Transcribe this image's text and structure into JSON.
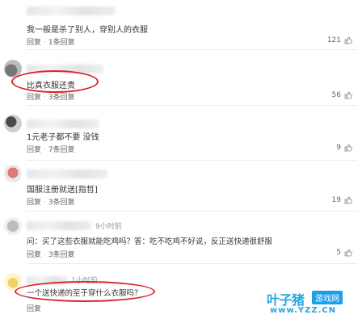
{
  "comments": [
    {
      "text": "我一般是杀了别人，穿别人的衣服",
      "reply_label": "回复",
      "replies_label": "1条回复",
      "likes": "121",
      "time": ""
    },
    {
      "text": "比真衣服还贵",
      "reply_label": "回复",
      "replies_label": "3条回复",
      "likes": "56",
      "time": ""
    },
    {
      "text": "1元老子都不要 没钱",
      "reply_label": "回复",
      "replies_label": "7条回复",
      "likes": "9",
      "time": ""
    },
    {
      "text": "国服注册就送[指哲]",
      "reply_label": "回复",
      "replies_label": "3条回复",
      "likes": "19",
      "time": ""
    },
    {
      "text": "问：买了这些衣服就能吃鸡吗？答：吃不吃鸡不好说，反正送快递很舒服",
      "reply_label": "回复",
      "replies_label": "3条回复",
      "likes": "5",
      "time": "9小时前"
    },
    {
      "text": "一个送快递的至于穿什么衣服吗？",
      "reply_label": "回复",
      "replies_label": "",
      "likes": "",
      "time": "1小时前"
    }
  ],
  "watermark": {
    "main": "叶子猪",
    "badge": "游戏网",
    "url": "www.YZZ.CN"
  },
  "colors": {
    "highlight": "#d9262a",
    "watermark": "#25a7e0"
  }
}
